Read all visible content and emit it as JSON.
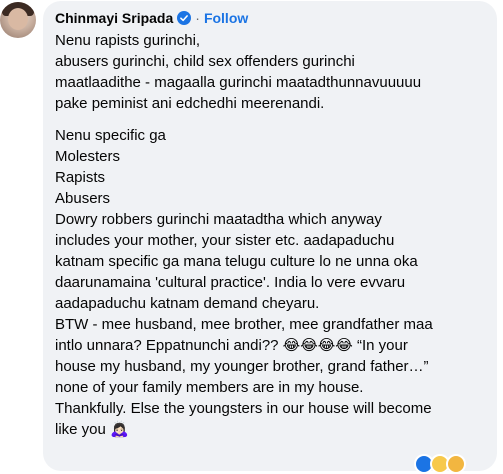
{
  "comment": {
    "author": "Chinmayi Sripada",
    "separator": "·",
    "follow_label": "Follow",
    "verified_icon": "verified-badge-icon",
    "accent_color": "#1b74e4",
    "paragraph1": [
      "Nenu rapists gurinchi,",
      "abusers gurinchi, child sex offenders gurinchi",
      "maatlaadithe - magaalla gurinchi maatadthunnavuuuuu",
      "pake peminist ani edchedhi meerenandi."
    ],
    "paragraph2": [
      "Nenu specific ga",
      "Molesters",
      "Rapists",
      "Abusers",
      "Dowry robbers gurinchi maatadtha which anyway",
      "includes your mother, your sister etc. aadapaduchu",
      "katnam specific ga mana telugu culture lo ne unna oka",
      "daarunamaina 'cultural practice'. India lo vere evvaru",
      "aadapaduchu katnam demand cheyaru.",
      "BTW - mee husband, mee brother, mee grandfather maa",
      "intlo unnara? Eppatnunchi andi?? 😂😂😂😂 “In your",
      "house my husband, my younger brother, grand father…”",
      "none of your family members are in my house.",
      "Thankfully. Else the youngsters in our house will become",
      "like you 🙇🏻‍♀️"
    ]
  }
}
